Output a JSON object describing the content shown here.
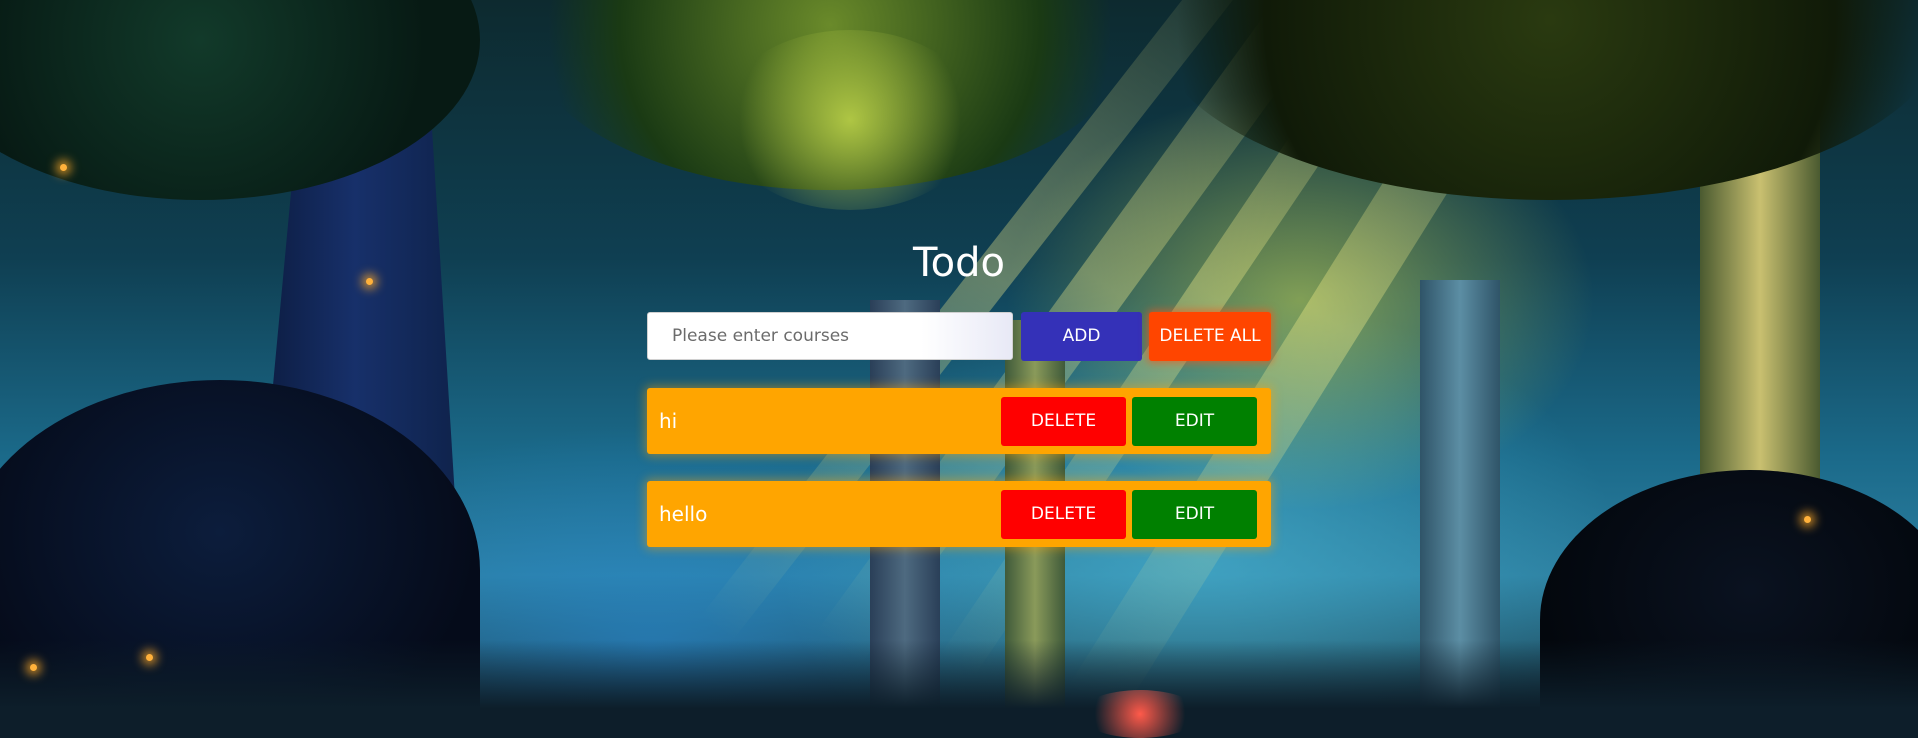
{
  "app": {
    "title": "Todo"
  },
  "form": {
    "input_value": "",
    "input_placeholder": "Please enter courses",
    "add_label": "ADD",
    "delete_all_label": "DELETE ALL"
  },
  "todos": [
    {
      "text": "hi",
      "delete_label": "DELETE",
      "edit_label": "EDIT"
    },
    {
      "text": "hello",
      "delete_label": "DELETE",
      "edit_label": "EDIT"
    }
  ],
  "colors": {
    "add_button": "#3431b8",
    "delete_all_button": "#ff4500",
    "todo_item": "#ffa500",
    "delete_button": "#ff0000",
    "edit_button": "#008000",
    "title_text": "#ffffff"
  },
  "background": {
    "description_icon": "forest-background-image"
  }
}
